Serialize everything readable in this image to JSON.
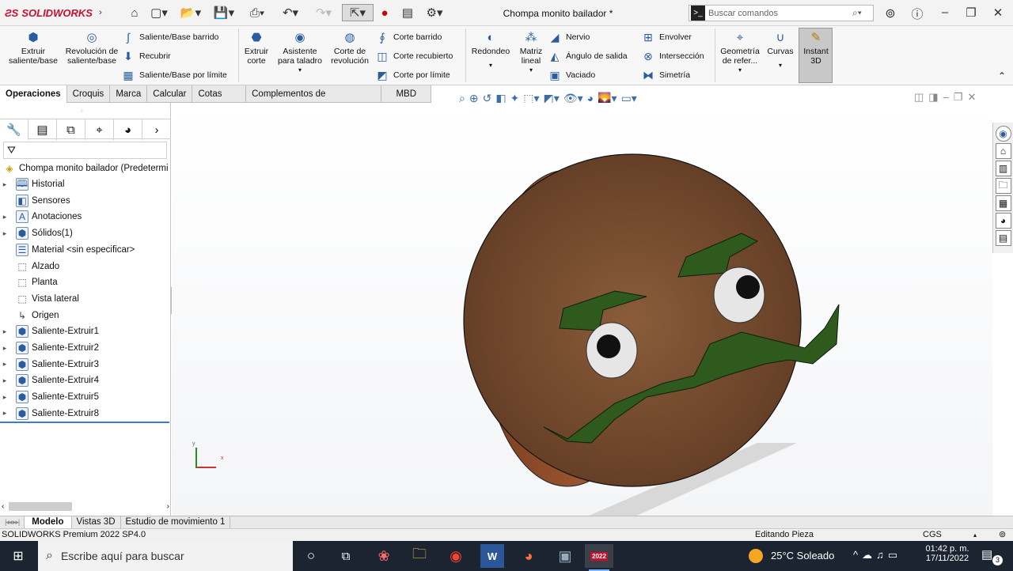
{
  "app": {
    "brand": "SOLIDWORKS",
    "doc_title": "Chompa monito bailador *",
    "search_placeholder": "Buscar comandos"
  },
  "ribbon": {
    "big": [
      {
        "id": "extrude",
        "label": "Extruir saliente/base"
      },
      {
        "id": "revolve",
        "label": "Revolución de saliente/base"
      },
      {
        "id": "cut",
        "label": "Extruir corte"
      },
      {
        "id": "hole",
        "label": "Asistente para taladro"
      },
      {
        "id": "rcut",
        "label": "Corte de revolución"
      },
      {
        "id": "fillet",
        "label": "Redondeo"
      },
      {
        "id": "pattern",
        "label": "Matriz lineal"
      },
      {
        "id": "refgeom",
        "label": "Geometría de refer..."
      },
      {
        "id": "curves",
        "label": "Curvas"
      },
      {
        "id": "instant",
        "label": "Instant 3D"
      }
    ],
    "small": [
      "Saliente/Base barrido",
      "Recubrir",
      "Saliente/Base por límite",
      "Corte barrido",
      "Corte recubierto",
      "Corte por límite",
      "Nervio",
      "Ángulo de salida",
      "Vaciado",
      "Envolver",
      "Intersección",
      "Simetría"
    ]
  },
  "tabs": [
    "Operaciones",
    "Croquis",
    "Marca",
    "Calcular",
    "Cotas MBD",
    "Complementos de SOLIDWORKS",
    "MBD"
  ],
  "active_tab": "Operaciones",
  "tree": {
    "root": "Chompa monito bailador  (Predetermi",
    "items": [
      {
        "label": "Historial",
        "expand": true
      },
      {
        "label": "Sensores",
        "expand": false
      },
      {
        "label": "Anotaciones",
        "expand": true
      },
      {
        "label": "Sólidos(1)",
        "expand": true
      },
      {
        "label": "Material <sin especificar>",
        "expand": false
      },
      {
        "label": "Alzado",
        "expand": false
      },
      {
        "label": "Planta",
        "expand": false
      },
      {
        "label": "Vista lateral",
        "expand": false
      },
      {
        "label": "Origen",
        "expand": false
      },
      {
        "label": "Saliente-Extruir1",
        "expand": true
      },
      {
        "label": "Saliente-Extruir2",
        "expand": true
      },
      {
        "label": "Saliente-Extruir3",
        "expand": true
      },
      {
        "label": "Saliente-Extruir4",
        "expand": true
      },
      {
        "label": "Saliente-Extruir5",
        "expand": true
      },
      {
        "label": "Saliente-Extruir8",
        "expand": true
      }
    ]
  },
  "bottom_tabs": [
    "Modelo",
    "Vistas 3D",
    "Estudio de movimiento 1"
  ],
  "status": {
    "left": "SOLIDWORKS Premium 2022 SP4.0",
    "mode": "Editando Pieza",
    "units": "CGS"
  },
  "taskbar": {
    "search_placeholder": "Escribe aquí para buscar",
    "weather": "25°C  Soleado",
    "time": "01:42 p. m.",
    "date": "17/11/2022",
    "notif": "3",
    "sw_badge": "2022"
  },
  "axes": {
    "x": "x",
    "y": "y"
  },
  "colors": {
    "brand": "#c8102e",
    "wood": "#8a4a2a",
    "green": "#2f5a1e",
    "taskbar": "#1c2431"
  }
}
